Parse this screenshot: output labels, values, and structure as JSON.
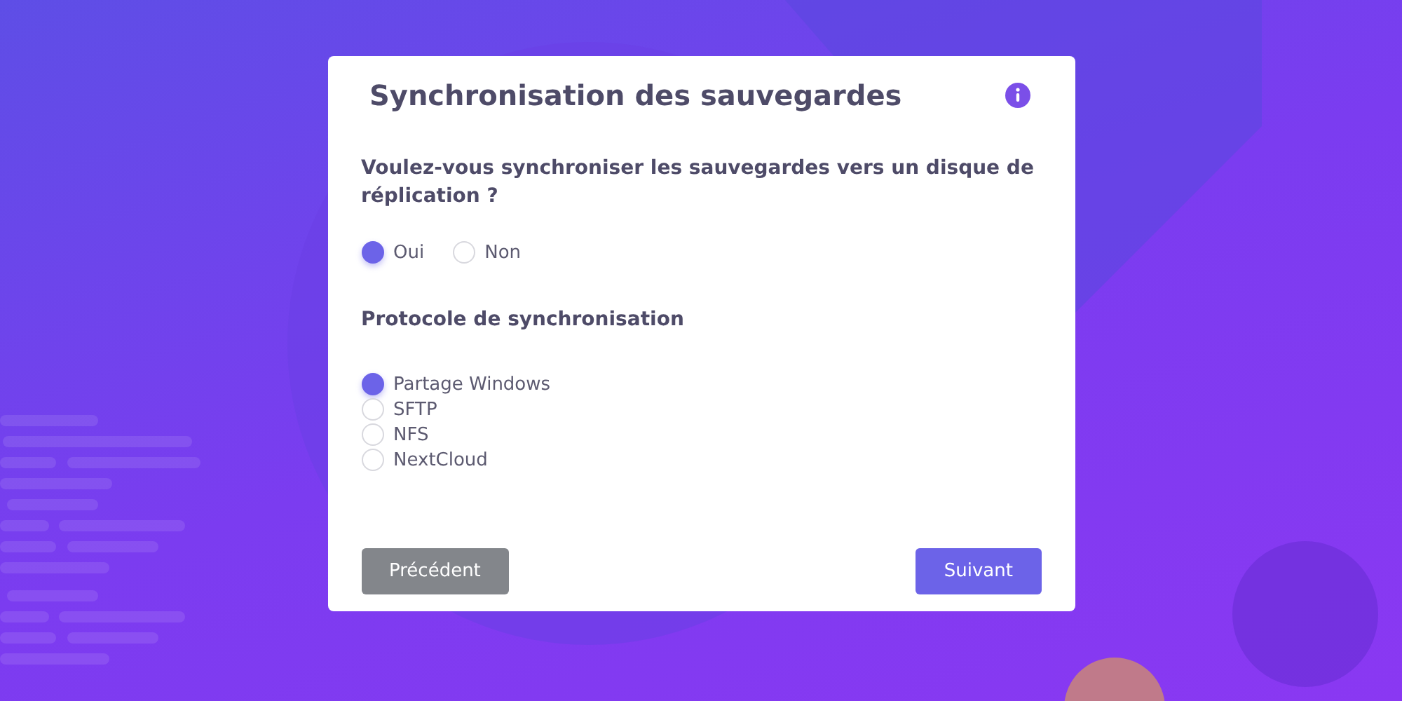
{
  "dialog": {
    "title": "Synchronisation des sauvegardes"
  },
  "question": {
    "label": "Voulez-vous synchroniser les sauvegardes vers un disque de réplication ?",
    "options": [
      {
        "label": "Oui",
        "selected": true
      },
      {
        "label": "Non",
        "selected": false
      }
    ]
  },
  "protocol": {
    "label": "Protocole de synchronisation",
    "options": [
      {
        "label": "Partage Windows",
        "selected": true
      },
      {
        "label": "SFTP",
        "selected": false
      },
      {
        "label": "NFS",
        "selected": false
      },
      {
        "label": "NextCloud",
        "selected": false
      }
    ]
  },
  "buttons": {
    "previous": "Précédent",
    "next": "Suivant"
  }
}
